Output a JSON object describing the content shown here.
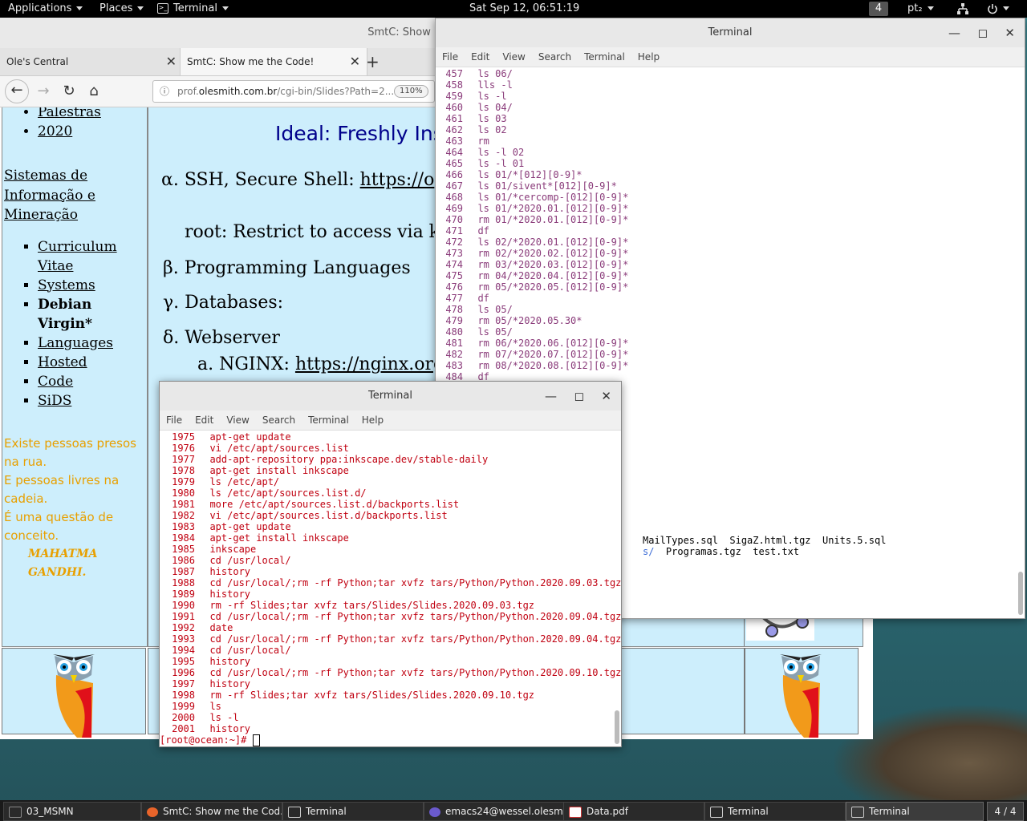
{
  "topbar": {
    "applications": "Applications",
    "places": "Places",
    "terminal": "Terminal",
    "clock": "Sat Sep 12, 06:51:19",
    "workspace": "4",
    "keyboard": "pt₂"
  },
  "browser": {
    "window_title": "SmtC: Show me the Code!",
    "tabs": [
      "Ole's Central",
      "SmtC: Show me the Code!"
    ],
    "url_host": "prof.olesmith.com.br",
    "url_path": "/cgi-bin/Slides?Path=2...",
    "url_prefix": "prof.",
    "url_domain": "olesmith.com.br",
    "zoom": "110%",
    "left_pane": {
      "top_links": [
        "Palestras",
        "2020"
      ],
      "section_link": "Sistemas de Informação e Mineração",
      "menu": [
        "Curriculum Vitae",
        "Systems"
      ],
      "current": "Debian Virgin*",
      "submenu": [
        "Languages",
        "Hosted"
      ],
      "menu2": [
        "Code",
        "SiDS"
      ],
      "quote": [
        "Existe pessoas presos na rua.",
        "E pessoas livres na cadeia.",
        "É uma questão de conceito."
      ],
      "quote_author": "MAHATMA GANDHI."
    },
    "slide": {
      "title": "Ideal: Freshly Inst",
      "item_a": "α. SSH, Secure Shell: ",
      "item_a_link": "https://o",
      "item_a_sub": "root: Restrict to access via k",
      "item_b": "β. Programming Languages",
      "item_c": "γ. Databases:",
      "item_d": "δ. Webserver",
      "item_d_sub": "a. NGINX: ",
      "item_d_sub_link": "https://nginx.org"
    }
  },
  "terminal_back": {
    "title": "Terminal",
    "menu": [
      "File",
      "Edit",
      "View",
      "Search",
      "Terminal",
      "Help"
    ],
    "lines": [
      {
        "n": "457",
        "c": "ls 06/"
      },
      {
        "n": "458",
        "c": "lls -l"
      },
      {
        "n": "459",
        "c": "ls -l"
      },
      {
        "n": "460",
        "c": "ls 04/"
      },
      {
        "n": "461",
        "c": "ls 03"
      },
      {
        "n": "462",
        "c": "ls 02"
      },
      {
        "n": "463",
        "c": "rm"
      },
      {
        "n": "464",
        "c": "ls -l 02"
      },
      {
        "n": "465",
        "c": "ls -l 01"
      },
      {
        "n": "466",
        "c": "ls 01/*[012][0-9]*"
      },
      {
        "n": "467",
        "c": "ls 01/sivent*[012][0-9]*"
      },
      {
        "n": "468",
        "c": "ls 01/*cercomp-[012][0-9]*"
      },
      {
        "n": "469",
        "c": "ls 01/*2020.01.[012][0-9]*"
      },
      {
        "n": "470",
        "c": "rm 01/*2020.01.[012][0-9]*"
      },
      {
        "n": "471",
        "c": "df"
      },
      {
        "n": "472",
        "c": "ls 02/*2020.01.[012][0-9]*"
      },
      {
        "n": "473",
        "c": "rm 02/*2020.02.[012][0-9]*"
      },
      {
        "n": "474",
        "c": "rm 03/*2020.03.[012][0-9]*"
      },
      {
        "n": "475",
        "c": "rm 04/*2020.04.[012][0-9]*"
      },
      {
        "n": "476",
        "c": "rm 05/*2020.05.[012][0-9]*"
      },
      {
        "n": "477",
        "c": "df"
      },
      {
        "n": "478",
        "c": "ls 05/"
      },
      {
        "n": "479",
        "c": "rm 05/*2020.05.30*"
      },
      {
        "n": "480",
        "c": "ls 05/"
      },
      {
        "n": "481",
        "c": "rm 06/*2020.06.[012][0-9]*"
      },
      {
        "n": "482",
        "c": "rm 07/*2020.07.[012][0-9]*"
      },
      {
        "n": "483",
        "c": "rm 08/*2020.08.[012][0-9]*"
      },
      {
        "n": "484",
        "c": "df"
      }
    ],
    "files_row1": "MailTypes.sql  SigaZ.html.tgz  Units.5.sql",
    "files_row2_blue": "s/",
    "files_row2": "  Programas.tgz  test.txt"
  },
  "terminal_front": {
    "title": "Terminal",
    "menu": [
      "File",
      "Edit",
      "View",
      "Search",
      "Terminal",
      "Help"
    ],
    "lines": [
      {
        "n": "1975",
        "c": "apt-get update"
      },
      {
        "n": "1976",
        "c": "vi /etc/apt/sources.list"
      },
      {
        "n": "1977",
        "c": "add-apt-repository ppa:inkscape.dev/stable-daily"
      },
      {
        "n": "1978",
        "c": "apt-get install inkscape"
      },
      {
        "n": "1979",
        "c": "ls /etc/apt/"
      },
      {
        "n": "1980",
        "c": "ls /etc/apt/sources.list.d/"
      },
      {
        "n": "1981",
        "c": "more /etc/apt/sources.list.d/backports.list"
      },
      {
        "n": "1982",
        "c": "vi /etc/apt/sources.list.d/backports.list"
      },
      {
        "n": "1983",
        "c": "apt-get update"
      },
      {
        "n": "1984",
        "c": "apt-get install inkscape"
      },
      {
        "n": "1985",
        "c": "inkscape"
      },
      {
        "n": "1986",
        "c": "cd /usr/local/"
      },
      {
        "n": "1987",
        "c": "history"
      },
      {
        "n": "1988",
        "c": "cd /usr/local/;rm -rf Python;tar xvfz tars/Python/Python.2020.09.03.tgz"
      },
      {
        "n": "1989",
        "c": "history"
      },
      {
        "n": "1990",
        "c": "rm -rf Slides;tar xvfz tars/Slides/Slides.2020.09.03.tgz"
      },
      {
        "n": "1991",
        "c": "cd /usr/local/;rm -rf Python;tar xvfz tars/Python/Python.2020.09.04.tgz"
      },
      {
        "n": "1992",
        "c": "date"
      },
      {
        "n": "1993",
        "c": "cd /usr/local/;rm -rf Python;tar xvfz tars/Python/Python.2020.09.04.tgz"
      },
      {
        "n": "1994",
        "c": "cd /usr/local/"
      },
      {
        "n": "1995",
        "c": "history"
      },
      {
        "n": "1996",
        "c": "cd /usr/local/;rm -rf Python;tar xvfz tars/Python/Python.2020.09.10.tgz"
      },
      {
        "n": "1997",
        "c": "history"
      },
      {
        "n": "1998",
        "c": "rm -rf Slides;tar xvfz tars/Slides/Slides.2020.09.10.tgz"
      },
      {
        "n": "1999",
        "c": "ls"
      },
      {
        "n": "2000",
        "c": "ls -l"
      },
      {
        "n": "2001",
        "c": "history"
      }
    ],
    "prompt": "[root@ocean:~]# "
  },
  "taskbar": {
    "tasks": [
      "03_MSMN",
      "SmtC: Show me the Cod...",
      "Terminal",
      "emacs24@wessel.olesmi...",
      "Data.pdf",
      "Terminal",
      "Terminal"
    ],
    "workspace_pager": "4 / 4"
  },
  "colors": {
    "slide_bg": "#cdeefc",
    "slide_title": "#00008b",
    "quote": "#e8a000",
    "term_front_text": "#c00010",
    "term_back_text": "#8a3b7a"
  }
}
